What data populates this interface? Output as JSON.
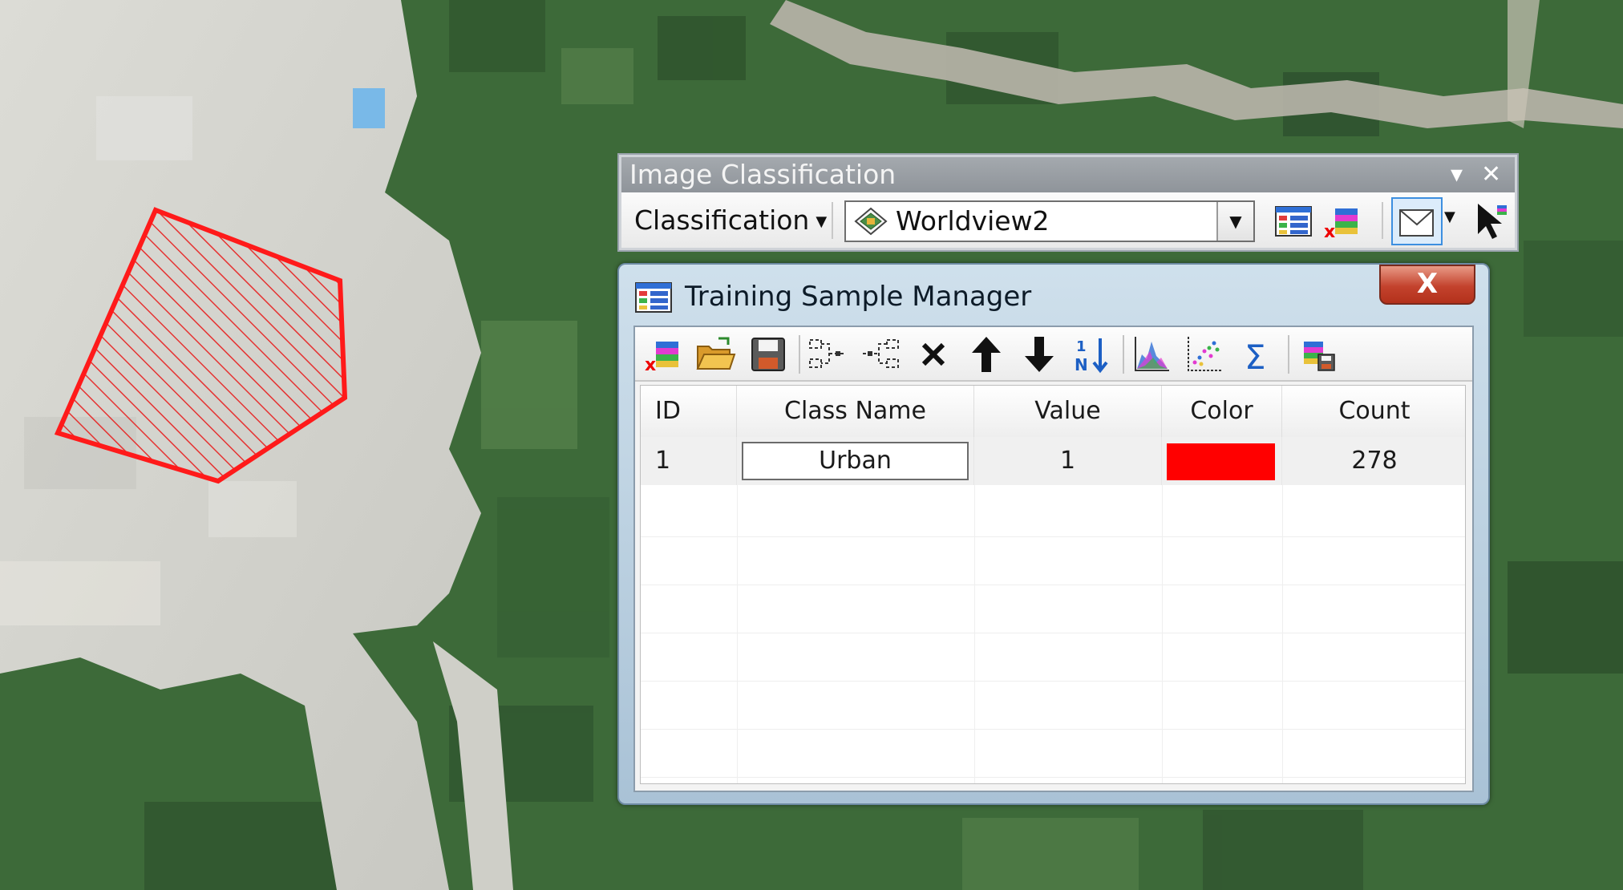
{
  "toolbar": {
    "title": "Image Classification",
    "classification_label": "Classification",
    "layer_value": "Worldview2",
    "icons": [
      "training-sample-manager-icon",
      "clear-samples-icon",
      "draw-polygon-icon",
      "select-pointer-icon"
    ]
  },
  "tsm": {
    "title": "Training Sample Manager",
    "close_glyph": "X",
    "tools": [
      "delete-samples-icon",
      "open-icon",
      "save-icon",
      "merge-icon",
      "split-icon",
      "delete-icon",
      "move-up-icon",
      "move-down-icon",
      "reset-ids-icon",
      "histogram-icon",
      "scatterplot-icon",
      "statistics-icon",
      "create-signature-icon"
    ],
    "columns": [
      "ID",
      "Class Name",
      "Value",
      "Color",
      "Count"
    ],
    "rows": [
      {
        "id": "1",
        "class_name": "Urban",
        "value": "1",
        "color": "#ff0000",
        "count": "278"
      }
    ]
  },
  "colors": {
    "sample_outline": "#ff1a1a",
    "class_color": "#ff0000"
  }
}
